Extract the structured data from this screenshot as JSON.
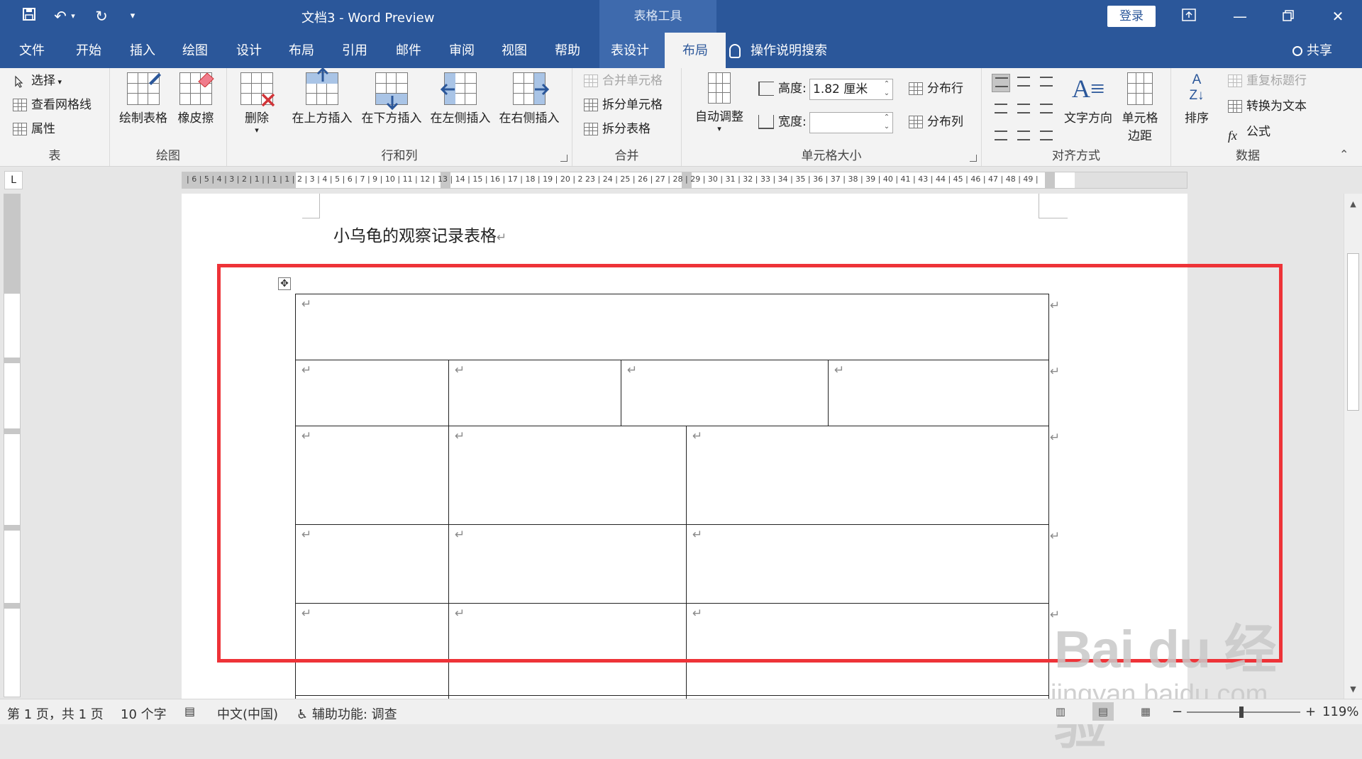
{
  "titlebar": {
    "doc_title": "文档3  -  Word Preview",
    "context_tools": "表格工具",
    "login": "登录"
  },
  "tabs": [
    "文件",
    "开始",
    "插入",
    "绘图",
    "设计",
    "布局",
    "引用",
    "邮件",
    "审阅",
    "视图",
    "帮助",
    "表设计",
    "布局"
  ],
  "active_tab": "布局",
  "tell_me": "操作说明搜索",
  "share": "共享",
  "ribbon": {
    "table": {
      "label": "表",
      "select": "选择",
      "gridlines": "查看网格线",
      "properties": "属性"
    },
    "draw": {
      "label": "绘图",
      "draw_table": "绘制表格",
      "eraser": "橡皮擦"
    },
    "rows_cols": {
      "label": "行和列",
      "delete": "删除",
      "insert_above": "在上方插入",
      "insert_below": "在下方插入",
      "insert_left": "在左侧插入",
      "insert_right": "在右侧插入"
    },
    "merge": {
      "label": "合并",
      "merge_cells": "合并单元格",
      "split_cells": "拆分单元格",
      "split_table": "拆分表格"
    },
    "cell_size": {
      "label": "单元格大小",
      "autofit": "自动调整",
      "height_label": "高度:",
      "height_value": "1.82 厘米",
      "width_label": "宽度:",
      "width_value": "",
      "distribute_rows": "分布行",
      "distribute_cols": "分布列"
    },
    "alignment": {
      "label": "对齐方式",
      "text_direction": "文字方向",
      "cell_margins_1": "单元格",
      "cell_margins_2": "边距"
    },
    "data": {
      "label": "数据",
      "sort": "排序",
      "repeat_header": "重复标题行",
      "convert_to_text": "转换为文本",
      "formula": "公式"
    }
  },
  "ruler": {
    "text": "| 6 | 5 | 4 | 3 | 2 | 1 |    | 1 | 1 | 2 | 3 | 4 | 5 | 6 | 7 |    9 | 10 | 11 | 12 | 13 | 14 | 15 | 16 | 17 | 18 | 19 | 20 | 2      23 | 24 | 25 | 26 | 27 | 28 | 29 | 30 | 31 | 32 | 33 | 34 | 35 | 36 | 37 | 38 | 39 | 40 | 41 |    43 | 44 | 45 | 46 | 47 | 48 | 49 |"
  },
  "document": {
    "heading": "小乌龟的观察记录表格",
    "para_mark": "↵",
    "table_handle": "✥"
  },
  "status": {
    "page": "第 1 页，共 1 页",
    "words": "10 个字",
    "language": "中文(中国)",
    "accessibility": "辅助功能: 调查",
    "zoom": "119%",
    "zoom_fraction": 0.48
  },
  "watermark": {
    "logo": "Bai du 经验",
    "url": "jingyan.baidu.com"
  },
  "colors": {
    "titlebar": "#2b579a",
    "context_tab": "#3e6aad",
    "highlight": "#ee3338"
  }
}
